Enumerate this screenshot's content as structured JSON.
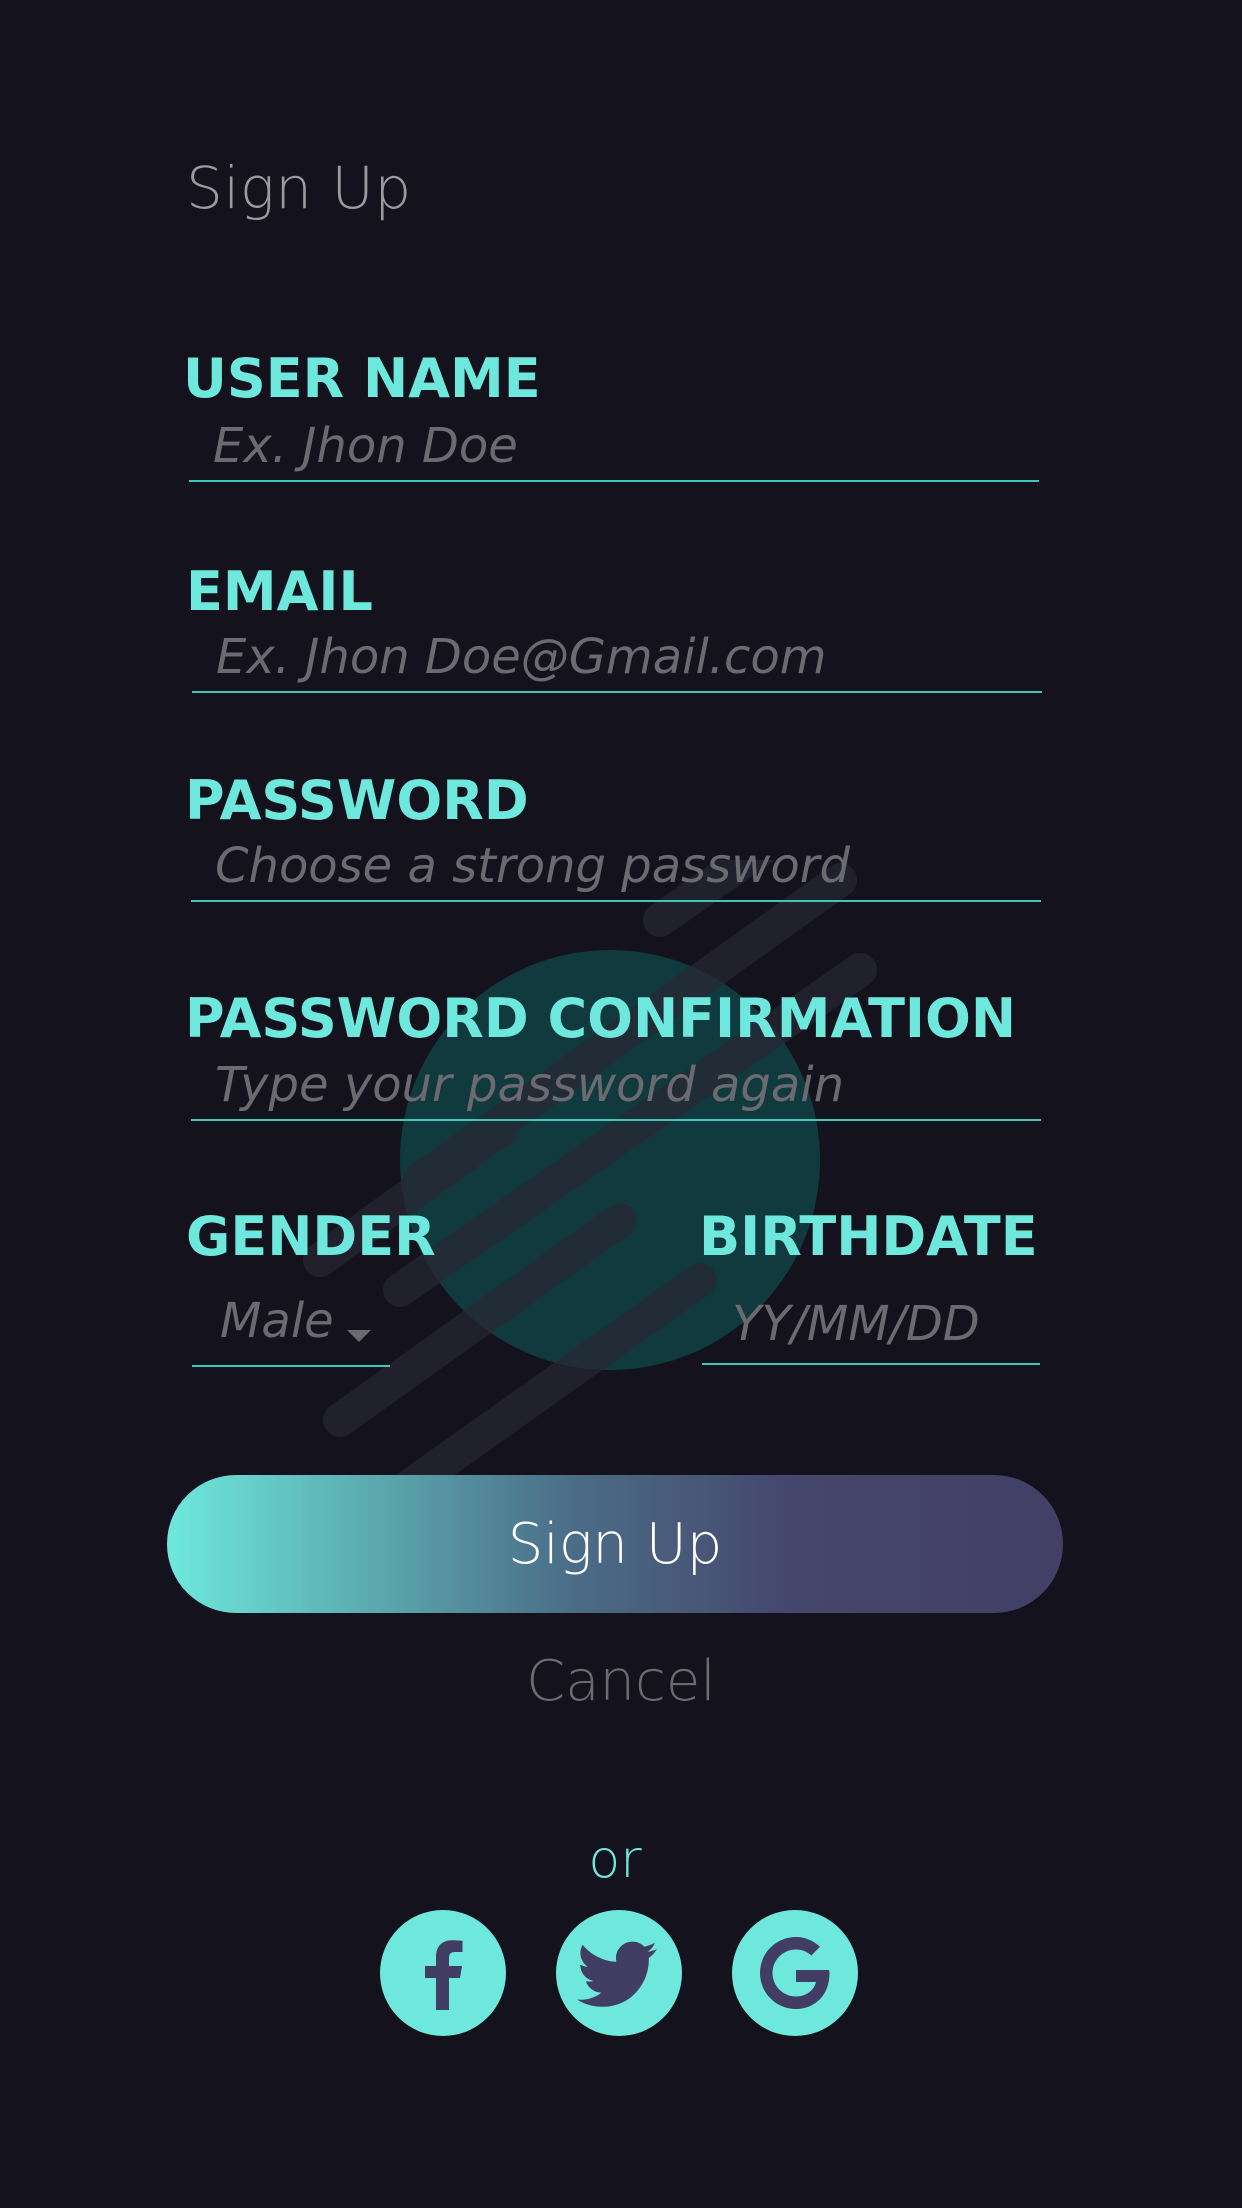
{
  "header": {
    "title": "Sign Up"
  },
  "form": {
    "username": {
      "label": "USER NAME",
      "placeholder": "Ex. Jhon Doe",
      "value": ""
    },
    "email": {
      "label": "EMAIL",
      "placeholder": "Ex. Jhon Doe@Gmail.com",
      "value": ""
    },
    "password": {
      "label": "PASSWORD",
      "placeholder": "Choose a strong password",
      "value": ""
    },
    "password_confirm": {
      "label": "PASSWORD CONFIRMATION",
      "placeholder": "Type your password again",
      "value": ""
    },
    "gender": {
      "label": "GENDER",
      "selected": "Male",
      "icon": "caret-down-icon"
    },
    "birthdate": {
      "label": "BIRTHDATE",
      "placeholder": "YY/MM/DD",
      "value": ""
    }
  },
  "actions": {
    "signup_label": "Sign Up",
    "cancel_label": "Cancel"
  },
  "social": {
    "or_label": "or",
    "providers": [
      {
        "icon": "facebook-icon"
      },
      {
        "icon": "twitter-icon"
      },
      {
        "icon": "google-icon"
      }
    ]
  },
  "colors": {
    "background": "#13121d",
    "accent": "#6ee8dd",
    "muted_text": "#6a6a70",
    "button_gradient_end": "#433f66",
    "icon_dark": "#413d63"
  }
}
